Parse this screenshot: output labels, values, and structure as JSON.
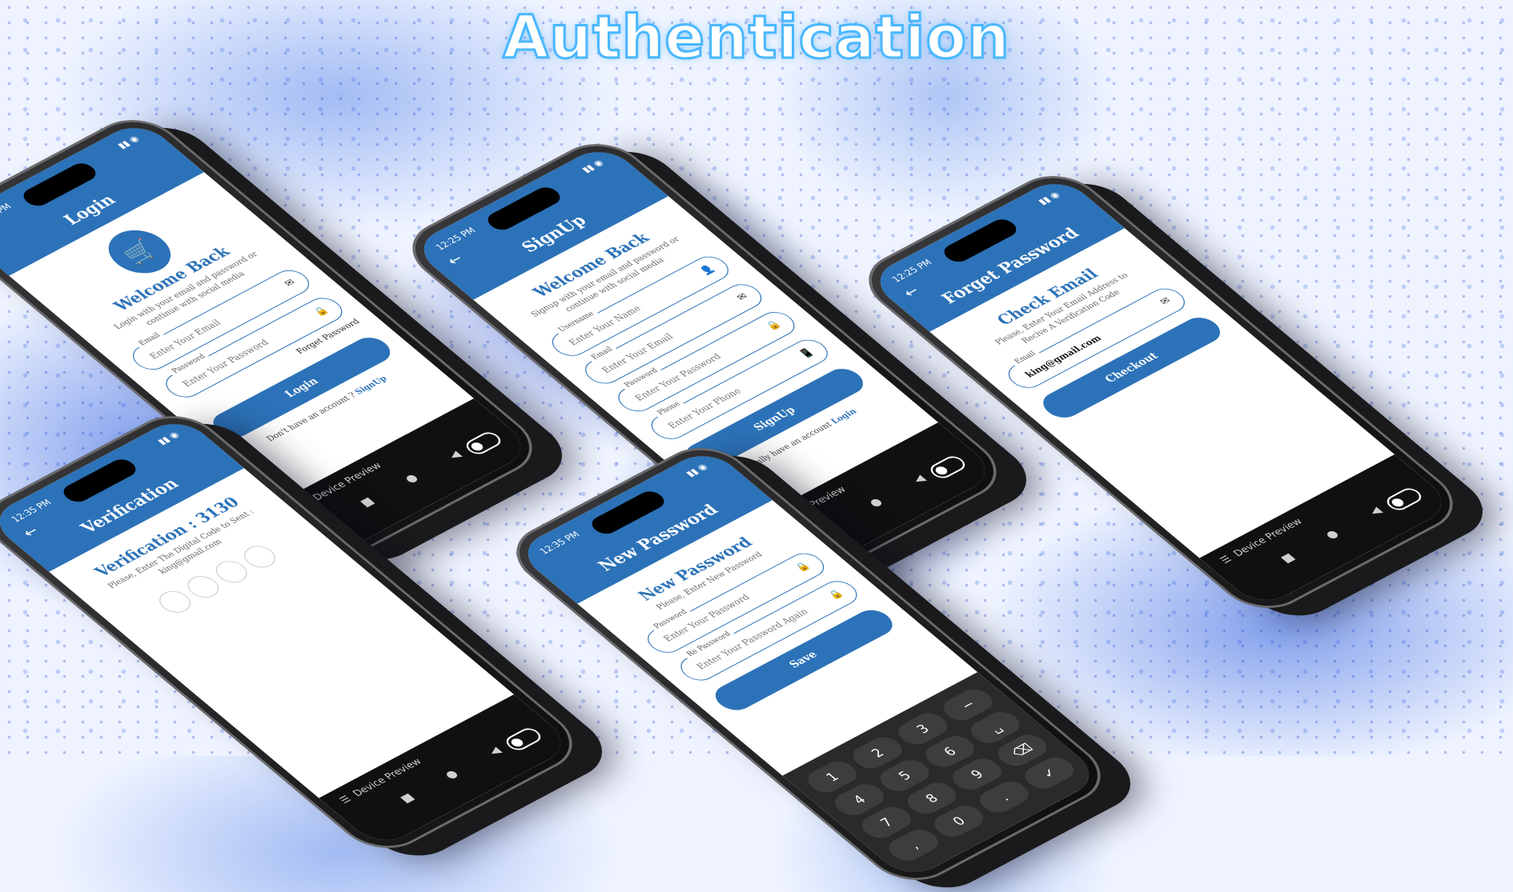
{
  "banner": {
    "title": "Authentication"
  },
  "common": {
    "status_time": "12:25 PM",
    "status_time_alt": "12:35 PM",
    "device_preview": "Device Preview",
    "status_icons": "▮▮ ◉",
    "back_icon": "←",
    "device_keys": [
      "■",
      "●",
      "◀"
    ]
  },
  "login": {
    "title": "Login",
    "heading": "Welcome Back",
    "subtext": "Login with your email and password or continue with social media",
    "email_label": "Email",
    "email_placeholder": "Enter Your Email",
    "password_label": "Password",
    "password_placeholder": "Enter Your Password",
    "forget_link": "Forget Password",
    "button": "Login",
    "footer_text": "Don't have an account ?",
    "footer_link": "SignUp"
  },
  "signup": {
    "title": "SignUp",
    "heading": "Welcome Back",
    "subtext": "Signup with your email and password or continue with social media",
    "username_label": "Username",
    "username_placeholder": "Enter Your Name",
    "email_label": "Email",
    "email_placeholder": "Enter Your Email",
    "password_label": "Password",
    "password_placeholder": "Enter Your Password",
    "phone_label": "Phone",
    "phone_placeholder": "Enter Your Phone",
    "button": "SignUp",
    "footer_text": "I really have an account",
    "footer_link": "Login"
  },
  "forget": {
    "title": "Forget Password",
    "heading": "Check Email",
    "subtext": "Please, Enter Your Email Address to Recive A Verification Code",
    "email_label": "Email",
    "email_value": "king@gmail.com",
    "button": "Checkout"
  },
  "verification": {
    "title": "Verification",
    "heading": "Verification : 3130",
    "subtext": "Please, Enter The Digital Code to Sent : king@gmail.com"
  },
  "newpass": {
    "title": "New Password",
    "heading": "New Password",
    "subtext": "Please, Enter New Password",
    "password_label": "Password",
    "password_placeholder": "Enter Your Password",
    "repassword_label": "Re Password",
    "repassword_placeholder": "Enter Your Password Again",
    "button": "Save",
    "keys": [
      "1",
      "2",
      "3",
      "−",
      "4",
      "5",
      "6",
      "␣",
      "7",
      "8",
      "9",
      "⌫",
      ",",
      "0",
      ".",
      "✓"
    ]
  }
}
